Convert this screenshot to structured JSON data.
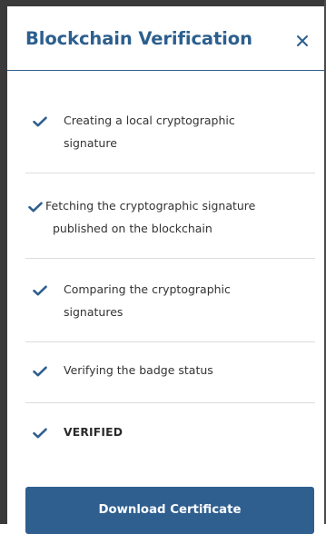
{
  "dialog": {
    "title": "Blockchain Verification",
    "close_icon": "close-icon",
    "accent_color": "#2f5f8f"
  },
  "steps": [
    {
      "icon": "checkmark-icon",
      "lines": [
        "Creating a local cryptographic",
        "signature"
      ]
    },
    {
      "icon": "checkmark-icon",
      "lines": [
        "Fetching the cryptographic signature",
        "published on the blockchain"
      ]
    },
    {
      "icon": "checkmark-icon",
      "lines": [
        "Comparing the cryptographic",
        "signatures"
      ]
    },
    {
      "icon": "checkmark-icon",
      "lines": [
        "Verifying the badge status"
      ]
    },
    {
      "icon": "checkmark-icon",
      "lines": [
        "VERIFIED"
      ]
    }
  ],
  "actions": {
    "download_label": "Download Certificate"
  }
}
